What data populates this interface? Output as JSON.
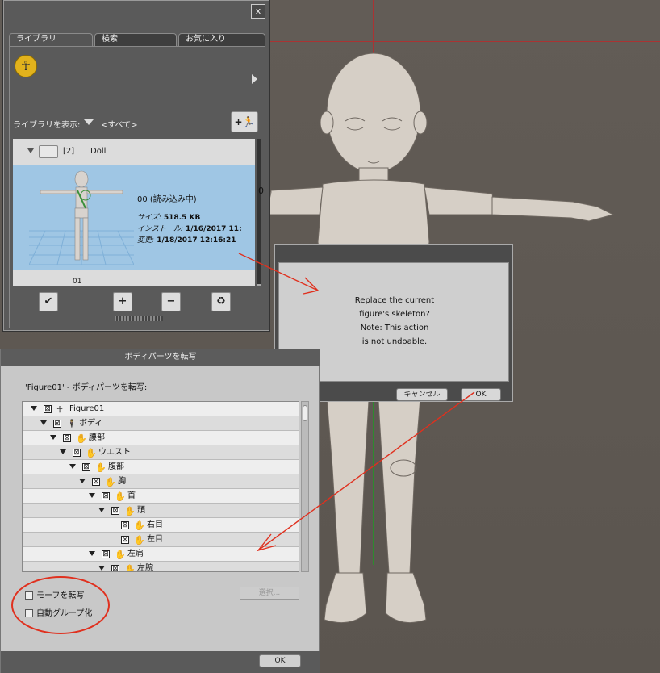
{
  "library": {
    "close_label": "x",
    "tabs": [
      {
        "label": "ライブラリ"
      },
      {
        "label": "検索"
      },
      {
        "label": "お気に入り"
      }
    ],
    "show_label": "ライブラリを表示:",
    "show_value": "<すべて>",
    "add_label": "+",
    "folder": {
      "count": "[2]",
      "name": "Doll"
    },
    "selected_item": {
      "title": "00 (読み込み中)",
      "size_label": "サイズ:",
      "size_value": "518.5 KB",
      "install_label": "インストール:",
      "install_value": "1/16/2017 11:",
      "modified_label": "変更:",
      "modified_value": "1/18/2017 12:16:21"
    },
    "second_item": "01",
    "buttons": {
      "apply": "✔",
      "add": "+",
      "remove": "−",
      "recycle": "♻"
    },
    "side_marker": "0"
  },
  "dialog": {
    "message_lines": [
      "Replace the current",
      "figure's skeleton?",
      "Note: This action",
      "is not undoable."
    ],
    "cancel_label": "キャンセル",
    "ok_label": "OK"
  },
  "transfer_panel": {
    "title": "ボディパーツを転写",
    "subtitle": "'Figure01' - ボディパーツを転写:",
    "tree": [
      {
        "label": "Figure01",
        "indent": 0,
        "expand": true,
        "check": "⊠",
        "icon": "figure"
      },
      {
        "label": "ボディ",
        "indent": 1,
        "expand": true,
        "check": "⊠",
        "icon": "body"
      },
      {
        "label": "腰部",
        "indent": 2,
        "expand": true,
        "check": "⊠",
        "icon": "hand"
      },
      {
        "label": "ウエスト",
        "indent": 3,
        "expand": true,
        "check": "⊠",
        "icon": "hand"
      },
      {
        "label": "腹部",
        "indent": 4,
        "expand": true,
        "check": "⊠",
        "icon": "hand"
      },
      {
        "label": "胸",
        "indent": 5,
        "expand": true,
        "check": "⊠",
        "icon": "hand"
      },
      {
        "label": "首",
        "indent": 6,
        "expand": true,
        "check": "⊠",
        "icon": "hand"
      },
      {
        "label": "頭",
        "indent": 7,
        "expand": true,
        "check": "⊠",
        "icon": "hand"
      },
      {
        "label": "右目",
        "indent": 8,
        "expand": false,
        "check": "⊠",
        "icon": "hand"
      },
      {
        "label": "左目",
        "indent": 8,
        "expand": false,
        "check": "⊠",
        "icon": "hand"
      },
      {
        "label": "左肩",
        "indent": 6,
        "expand": true,
        "check": "⊠",
        "icon": "hand"
      },
      {
        "label": "左腕",
        "indent": 7,
        "expand": true,
        "check": "⊠",
        "icon": "hand"
      }
    ],
    "options": [
      {
        "label": "モーフを転写"
      },
      {
        "label": "自動グループ化"
      }
    ],
    "select_label": "選択...",
    "ok_label": "OK"
  },
  "colors": {
    "annotation": "#e0301e",
    "selection": "#9fc6e4",
    "figure_body": "#d6cfc6"
  }
}
